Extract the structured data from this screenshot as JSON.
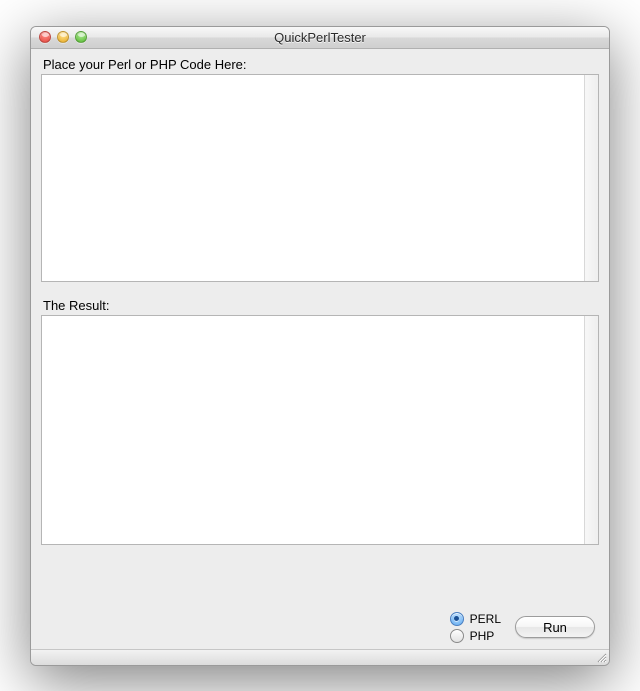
{
  "window": {
    "title": "QuickPerlTester"
  },
  "labels": {
    "code_input": "Place your Perl or PHP Code Here:",
    "result": "The Result:"
  },
  "fields": {
    "code_value": "",
    "result_value": ""
  },
  "language": {
    "options": {
      "perl": "PERL",
      "php": "PHP"
    },
    "selected": "perl"
  },
  "buttons": {
    "run": "Run"
  }
}
